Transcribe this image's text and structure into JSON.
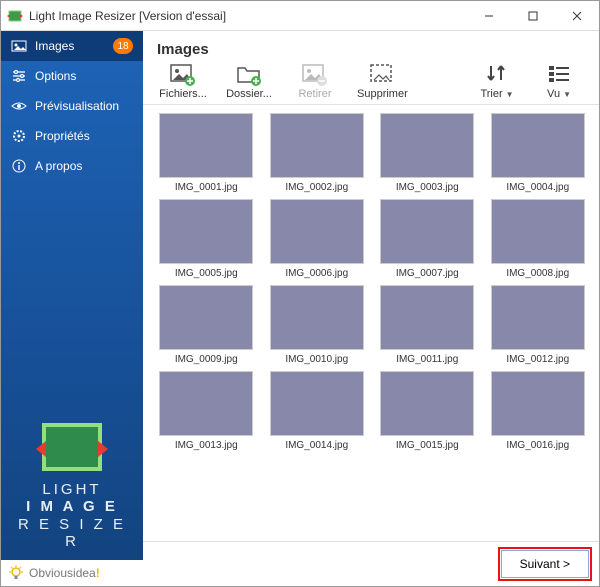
{
  "window": {
    "title": "Light Image Resizer  [Version d'essai]"
  },
  "sidebar": {
    "items": [
      {
        "label": "Images",
        "badge": "18"
      },
      {
        "label": "Options"
      },
      {
        "label": "Prévisualisation"
      },
      {
        "label": "Propriétés"
      },
      {
        "label": "A propos"
      }
    ],
    "wordmark_line1": "LIGHT",
    "wordmark_line2": "I M A G E",
    "wordmark_line3": "R E S I Z E R",
    "brand_text_a": "Obvious",
    "brand_text_b": "idea",
    "brand_exclaim": "!"
  },
  "main": {
    "heading": "Images",
    "toolbar": {
      "files": {
        "label": "Fichiers..."
      },
      "folder": {
        "label": "Dossier..."
      },
      "remove": {
        "label": "Retirer"
      },
      "delete": {
        "label": "Supprimer"
      },
      "sort": {
        "label": "Trier"
      },
      "view": {
        "label": "Vu"
      }
    },
    "images": [
      {
        "caption": "IMG_0001.jpg",
        "cls": "g1"
      },
      {
        "caption": "IMG_0002.jpg",
        "cls": "g2"
      },
      {
        "caption": "IMG_0003.jpg",
        "cls": "g3"
      },
      {
        "caption": "IMG_0004.jpg",
        "cls": "g4"
      },
      {
        "caption": "IMG_0005.jpg",
        "cls": "g5"
      },
      {
        "caption": "IMG_0006.jpg",
        "cls": "g6"
      },
      {
        "caption": "IMG_0007.jpg",
        "cls": "g7"
      },
      {
        "caption": "IMG_0008.jpg",
        "cls": "g8"
      },
      {
        "caption": "IMG_0009.jpg",
        "cls": "g9"
      },
      {
        "caption": "IMG_0010.jpg",
        "cls": "g10"
      },
      {
        "caption": "IMG_0011.jpg",
        "cls": "g11"
      },
      {
        "caption": "IMG_0012.jpg",
        "cls": "g12"
      },
      {
        "caption": "IMG_0013.jpg",
        "cls": "g13"
      },
      {
        "caption": "IMG_0014.jpg",
        "cls": "g14"
      },
      {
        "caption": "IMG_0015.jpg",
        "cls": "g15"
      },
      {
        "caption": "IMG_0016.jpg",
        "cls": "g16"
      }
    ]
  },
  "footer": {
    "next_label": "Suivant >"
  }
}
